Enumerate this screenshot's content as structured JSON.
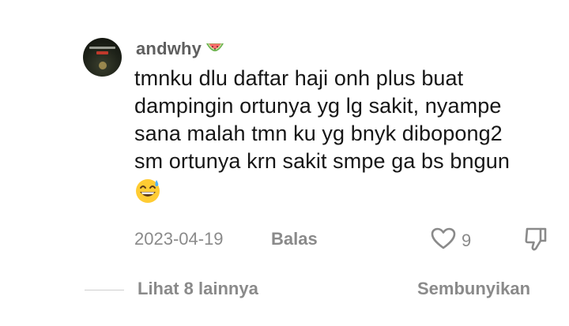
{
  "comment": {
    "username": "andwhy",
    "username_emoji": "watermelon-emoji",
    "text_lines": [
      "tmnku dlu daftar haji onh plus buat",
      "dampingin ortunya yg lg sakit, nyampe",
      "sana malah tmn ku yg bnyk dibopong2",
      "sm ortunya krn sakit smpe ga bs bngun"
    ],
    "trailing_emoji": "grinning-sweat-emoji",
    "date": "2023-04-19",
    "reply_label": "Balas",
    "like_count": "9",
    "icons": {
      "like": "heart-outline-icon",
      "dislike": "thumbs-down-outline-icon"
    }
  },
  "footer": {
    "more_label": "Lihat 8 lainnya",
    "hide_label": "Sembunyikan"
  },
  "colors": {
    "primary_text": "#161616",
    "secondary_text": "#8a8a8a",
    "username_text": "#5f5f5f",
    "divider": "#cfcfcf",
    "background": "#ffffff"
  }
}
